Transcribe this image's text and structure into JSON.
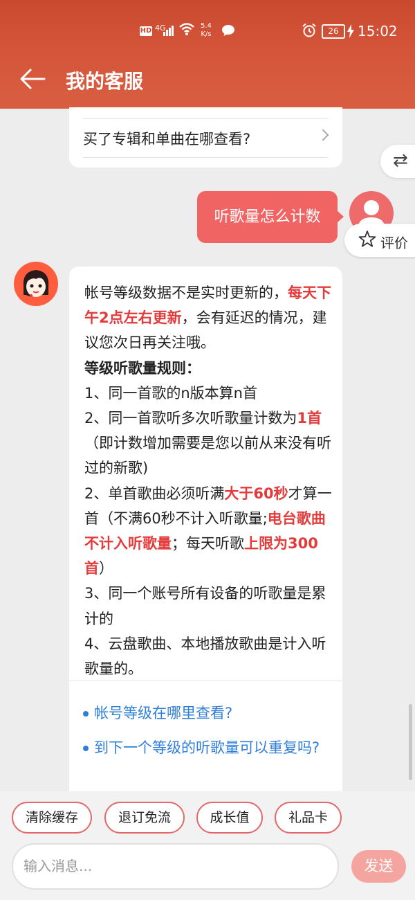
{
  "status_bar": {
    "hd": "HD",
    "signal": "4G",
    "speed_value": "5.4",
    "speed_unit": "K/s",
    "battery": "26",
    "time": "15:02"
  },
  "header": {
    "title": "我的客服"
  },
  "prev_question": {
    "text": "买了专辑和单曲在哪查看?"
  },
  "user_message": {
    "text": "听歌量怎么计数"
  },
  "rate_button": {
    "label": "评价"
  },
  "answer": {
    "p1_a": "帐号等级数据不是实时更新的，",
    "p1_red": "每天下午2点左右更新",
    "p1_b": "，会有延迟的情况，建议您次日再关注哦。",
    "heading": "等级听歌量规则：",
    "r1": "1、同一首歌的n版本算n首",
    "r2_a": "2、同一首歌听多次听歌量计数为",
    "r2_red": "1首",
    "r2_b": "（即计数增加需要是您以前从来没有听过的新歌)",
    "r3_a": "2、单首歌曲必须听满",
    "r3_red1": "大于60秒",
    "r3_b": "才算一首（不满60秒不计入听歌量;",
    "r3_red2": "电台歌曲不计入听歌量",
    "r3_c": "；每天听歌",
    "r3_red3": "上限为300首",
    "r3_d": "）",
    "r4": "3、同一个账号所有设备的听歌量是累计的",
    "r5": "4、云盘歌曲、本地播放歌曲是计入听歌量的。"
  },
  "related": [
    {
      "text": "帐号等级在哪里查看?"
    },
    {
      "text": "到下一个等级的听歌量可以重复吗?"
    }
  ],
  "quick_actions": [
    {
      "label": "清除缓存"
    },
    {
      "label": "退订免流"
    },
    {
      "label": "成长值"
    },
    {
      "label": "礼品卡"
    }
  ],
  "input": {
    "placeholder": "输入消息..."
  },
  "send": {
    "label": "发送"
  },
  "colors": {
    "accent": "#f06464",
    "header": "#d4553a",
    "link": "#2f7fd9",
    "highlight": "#e33b3b"
  }
}
